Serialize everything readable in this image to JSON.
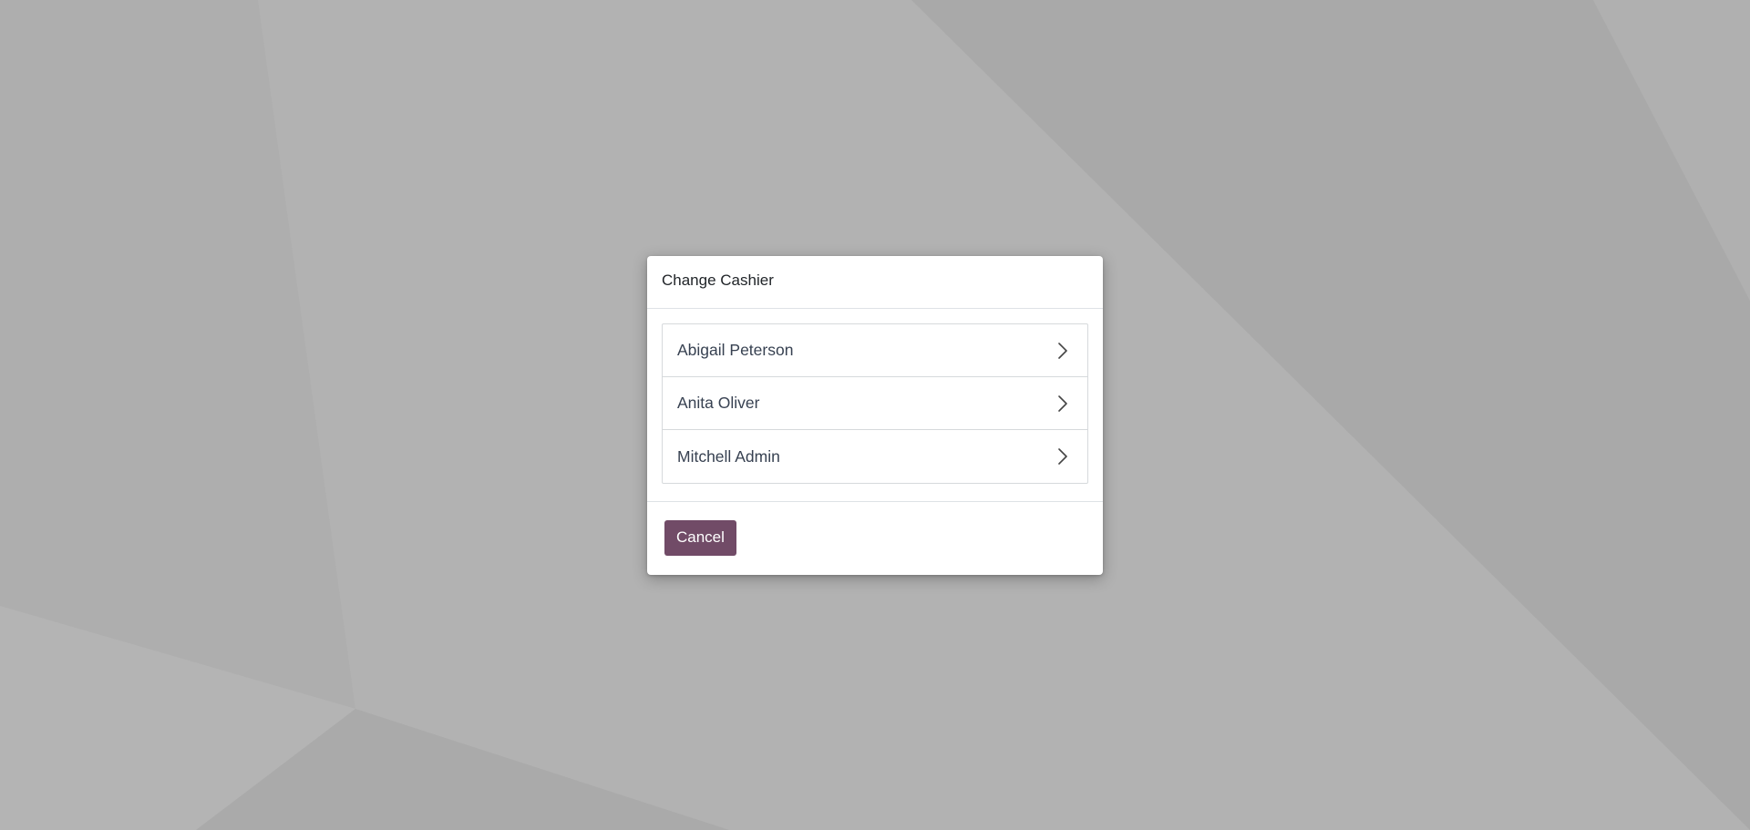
{
  "dialog": {
    "title": "Change Cashier",
    "cashiers": [
      {
        "name": "Abigail Peterson",
        "icon": "chevron-right-icon"
      },
      {
        "name": "Anita Oliver",
        "icon": "chevron-right-icon"
      },
      {
        "name": "Mitchell Admin",
        "icon": "chevron-right-icon"
      }
    ],
    "cancel_label": "Cancel"
  },
  "colors": {
    "background": "#b1b1b1",
    "dialog_background": "#ffffff",
    "primary_button": "#714b67",
    "list_border": "#d6d9dc"
  }
}
